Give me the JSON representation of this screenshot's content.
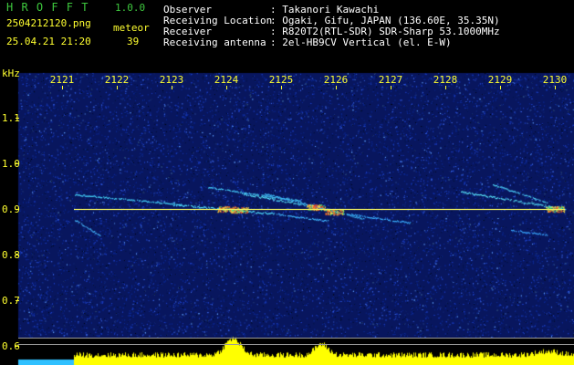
{
  "header": {
    "app_title": "H R O F F T",
    "version": "1.0.0",
    "filename": "2504212120.png",
    "datetime": "25.04.21 21:20",
    "count_label": "meteor",
    "count_value": "39",
    "info": [
      {
        "label": "Observer",
        "value": ": Takanori Kawachi"
      },
      {
        "label": "Receiving Location",
        "value": ": Ogaki, Gifu, JAPAN (136.60E, 35.35N)"
      },
      {
        "label": "Receiver",
        "value": ": R820T2(RTL-SDR) SDR-Sharp 53.1000MHz"
      },
      {
        "label": "Receiving antenna",
        "value": ": 2el-HB9CV Vertical (el. E-W)"
      }
    ]
  },
  "spectrogram": {
    "y_unit": "kHz",
    "y_ticks": [
      "1.1",
      "1.0",
      "0.9",
      "0.8",
      "0.7",
      "0.6"
    ],
    "x_ticks": [
      "2121",
      "2122",
      "2123",
      "2124",
      "2125",
      "2126",
      "2127",
      "2128",
      "2129",
      "2130"
    ],
    "colors": {
      "axis_text": "#ffff30",
      "header_green": "#3ec83e",
      "carrier_line": "#f0f060",
      "background_blue": "#0a1a6a",
      "level_fill": "#ffff00"
    }
  }
}
